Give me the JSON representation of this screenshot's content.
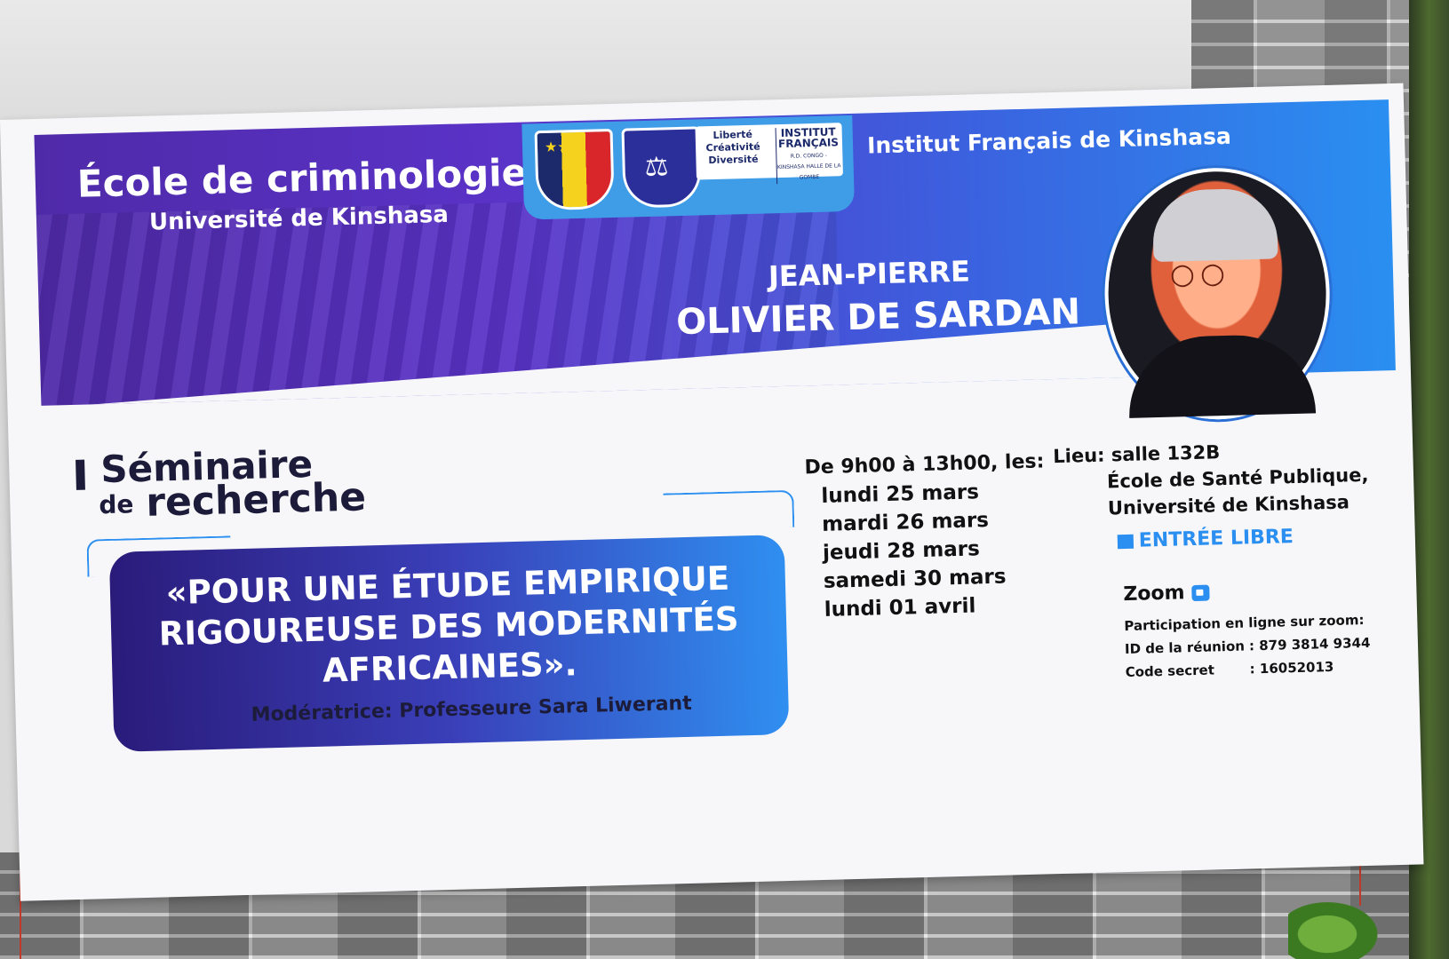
{
  "banner": {
    "school_title": "École de criminologie",
    "school_subtitle": "Université de Kinshasa",
    "partner": "Institut Français de Kinshasa",
    "logo_motto": [
      "Liberté",
      "Créativité",
      "Diversité"
    ],
    "logo_institut": [
      "INSTITUT",
      "FRANÇAIS"
    ],
    "logo_institut_small": "R.D. CONGO - KINSHASA HALLE DE LA GOMBE",
    "speaker_first": "JEAN-PIERRE",
    "speaker_last": "OLIVIER DE SARDAN",
    "seminar_line1": "Séminaire",
    "seminar_line2a": "de",
    "seminar_line2b": "recherche",
    "quote": "«POUR UNE ÉTUDE EMPIRIQUE RIGOUREUSE DES MODERNITÉS AFRICAINES».",
    "moderator": "Modératrice: Professeure Sara Liwerant",
    "schedule_header": "De 9h00 à 13h00, les:",
    "dates": [
      "lundi 25 mars",
      "mardi 26 mars",
      "jeudi 28 mars",
      "samedi 30 mars",
      "lundi 01 avril"
    ],
    "lieu_line1": "Lieu: salle 132B",
    "lieu_line2": "École de Santé Publique,",
    "lieu_line3": "Université de Kinshasa",
    "entree": "ENTRÉE LIBRE",
    "zoom_label": "Zoom",
    "zoom_participation": "Participation en ligne sur zoom:",
    "zoom_id_label": "ID de la réunion",
    "zoom_id_value": ": 879 3814 9344",
    "zoom_code_label": "Code secret",
    "zoom_code_value": ": 16052013"
  },
  "colors": {
    "band_start": "#4f2aa8",
    "band_end": "#2a8ff0",
    "accent_blue": "#2a8ff0",
    "text_dark": "#1c1c3a"
  },
  "icons": [
    "crest-icon",
    "justice-scale-icon",
    "zoom-camera-icon",
    "square-bullet-icon"
  ]
}
